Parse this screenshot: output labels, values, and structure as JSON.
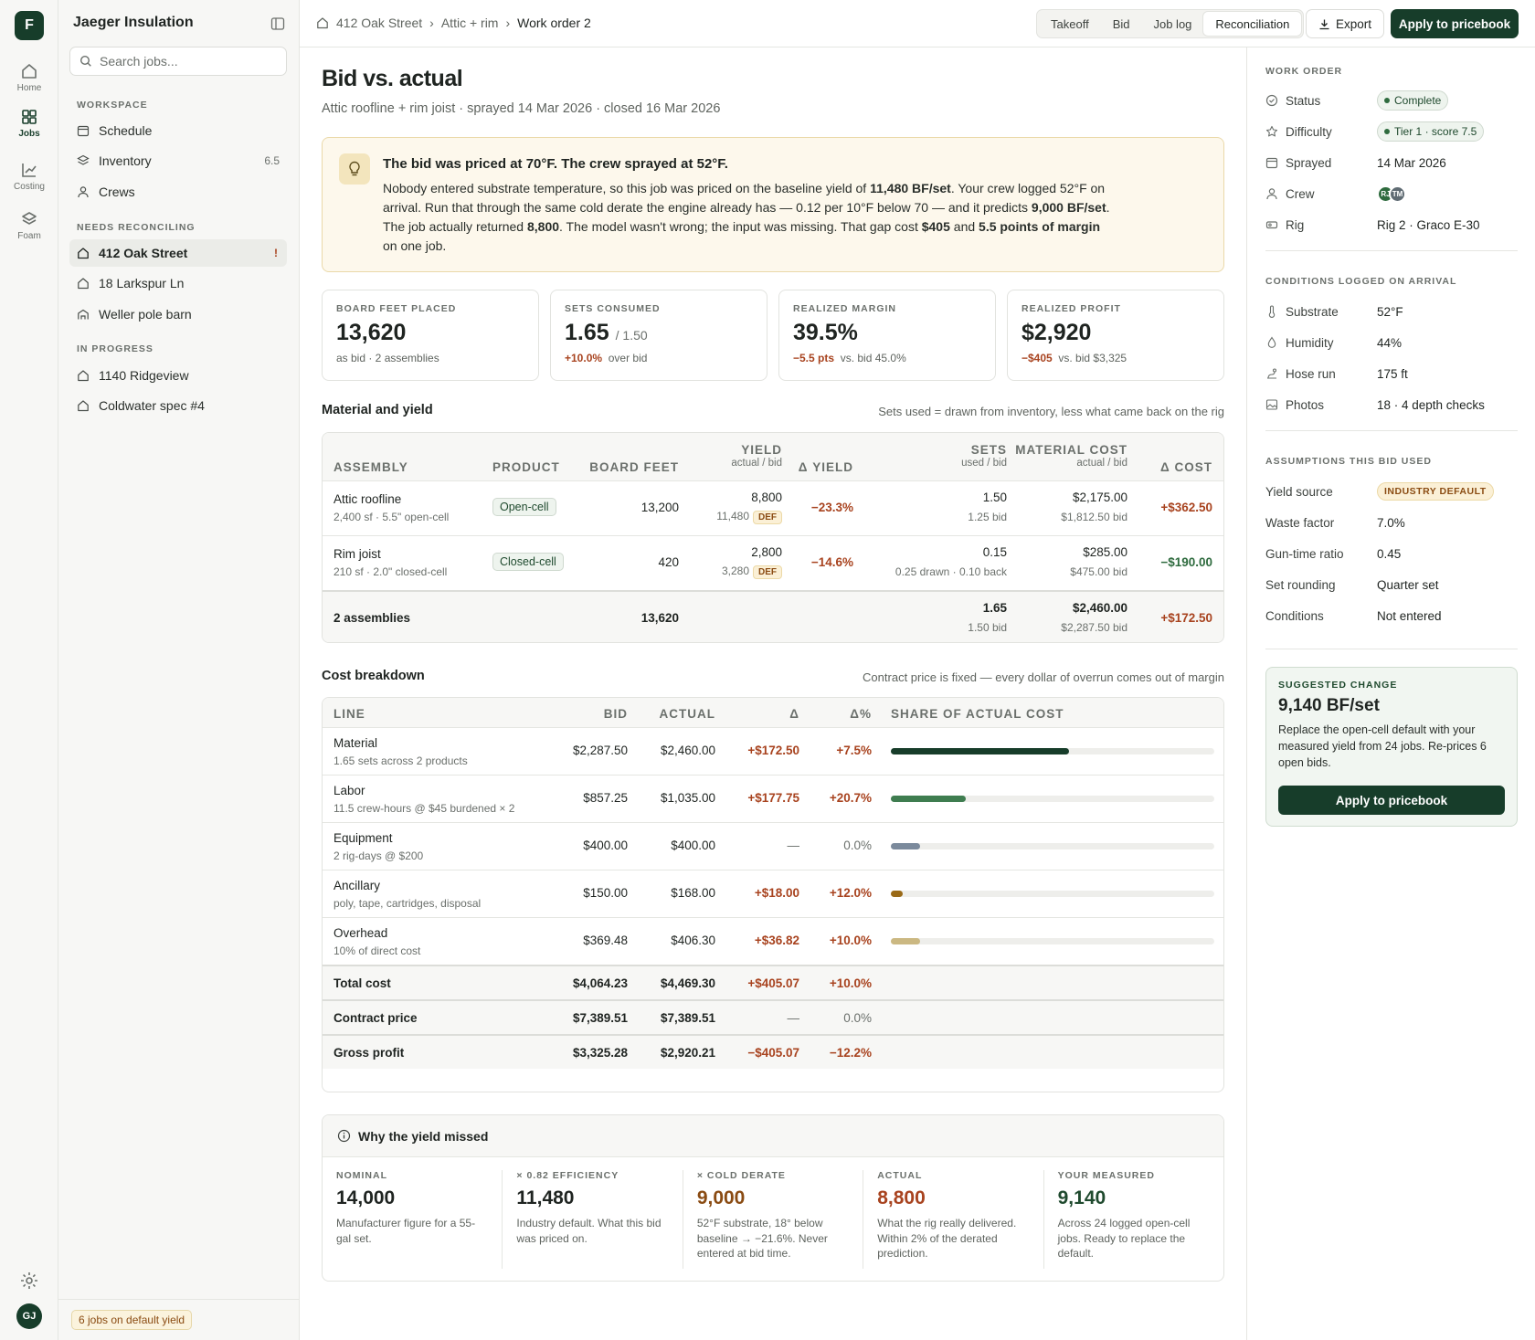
{
  "app": {
    "brand": "Jaeger Insulation",
    "logo_letter": "F",
    "user_initials": "GJ"
  },
  "rail": [
    {
      "label": "Home",
      "icon": "home-icon"
    },
    {
      "label": "Jobs",
      "icon": "jobs-icon"
    },
    {
      "label": "Costing",
      "icon": "costing-icon"
    },
    {
      "label": "Foam",
      "icon": "foam-icon"
    }
  ],
  "sidebar": {
    "search_placeholder": "Search jobs...",
    "workspace_label": "WORKSPACE",
    "workspace": [
      {
        "label": "Schedule",
        "count": ""
      },
      {
        "label": "Inventory",
        "count": "6.5"
      },
      {
        "label": "Crews",
        "count": ""
      }
    ],
    "reconciling_label": "NEEDS RECONCILING",
    "reconciling": [
      {
        "label": "412 Oak Street",
        "alert": "!"
      },
      {
        "label": "18 Larkspur Ln",
        "alert": ""
      },
      {
        "label": "Weller pole barn",
        "alert": ""
      }
    ],
    "progress_label": "IN PROGRESS",
    "progress": [
      {
        "label": "1140 Ridgeview"
      },
      {
        "label": "Coldwater spec #4"
      }
    ],
    "footer_badge": "6 jobs on default yield"
  },
  "topbar": {
    "breadcrumb": [
      "412 Oak Street",
      "Attic + rim",
      "Work order 2"
    ],
    "tabs": [
      "Takeoff",
      "Bid",
      "Job log",
      "Reconciliation"
    ],
    "active_tab": "Reconciliation",
    "export_label": "Export",
    "apply_label": "Apply to pricebook"
  },
  "page": {
    "title": "Bid vs. actual",
    "subtitle": "Attic roofline + rim joist · sprayed 14 Mar 2026 · closed 16 Mar 2026"
  },
  "callout": {
    "title": "The bid was priced at 70°F. The crew sprayed at 52°F.",
    "body": [
      {
        "t": "Nobody entered substrate temperature, so this job was priced on the baseline yield of ",
        "b": false
      },
      {
        "t": "11,480 BF/set",
        "b": true
      },
      {
        "t": ". Your crew logged 52°F on arrival. Run that through the same cold derate the engine already has — 0.12 per 10°F below 70 — and it predicts ",
        "b": false
      },
      {
        "t": "9,000 BF/set",
        "b": true
      },
      {
        "t": ". The job actually returned ",
        "b": false
      },
      {
        "t": "8,800",
        "b": true
      },
      {
        "t": ". The model wasn't wrong; the input was missing. That gap cost ",
        "b": false
      },
      {
        "t": "$405",
        "b": true
      },
      {
        "t": " and ",
        "b": false
      },
      {
        "t": "5.5 points of margin",
        "b": true
      },
      {
        "t": " on one job.",
        "b": false
      }
    ]
  },
  "kpis": [
    {
      "label": "BOARD FEET PLACED",
      "value": "13,620",
      "suffix": "",
      "delta": "",
      "sub": "as bid · 2 assemblies"
    },
    {
      "label": "SETS CONSUMED",
      "value": "1.65",
      "suffix": "/ 1.50",
      "delta": "+10.0%",
      "sub": "over bid"
    },
    {
      "label": "REALIZED MARGIN",
      "value": "39.5%",
      "suffix": "",
      "delta": "−5.5 pts",
      "sub": "vs. bid 45.0%"
    },
    {
      "label": "REALIZED PROFIT",
      "value": "$2,920",
      "suffix": "",
      "delta": "−$405",
      "sub": "vs. bid $3,325"
    }
  ],
  "material": {
    "title": "Material and yield",
    "note": "Sets used = drawn from inventory, less what came back on the rig",
    "headers": {
      "assembly": "ASSEMBLY",
      "product": "PRODUCT",
      "board_feet": "BOARD FEET",
      "yield": "YIELD",
      "yield_sub": "actual / bid",
      "d_yield": "Δ YIELD",
      "sets": "SETS",
      "sets_sub": "used / bid",
      "cost": "MATERIAL COST",
      "cost_sub": "actual / bid",
      "d_cost": "Δ COST"
    },
    "rows": [
      {
        "assembly": "Attic roofline",
        "detail": "2,400 sf · 5.5\" open-cell",
        "product": "Open-cell",
        "board_feet": "13,200",
        "yield_actual": "8,800",
        "yield_bid": "11,480",
        "def": "DEF",
        "d_yield": "−23.3%",
        "sets_used": "1.50",
        "sets_bid": "1.25 bid",
        "cost_actual": "$2,175.00",
        "cost_bid": "$1,812.50 bid",
        "d_cost": "+$362.50"
      },
      {
        "assembly": "Rim joist",
        "detail": "210 sf · 2.0\" closed-cell",
        "product": "Closed-cell",
        "board_feet": "420",
        "yield_actual": "2,800",
        "yield_bid": "3,280",
        "def": "DEF",
        "d_yield": "−14.6%",
        "sets_used": "0.15",
        "sets_bid": "0.25 drawn · 0.10 back",
        "cost_actual": "$285.00",
        "cost_bid": "$475.00 bid",
        "d_cost": "−$190.00"
      }
    ],
    "total": {
      "label": "2 assemblies",
      "board_feet": "13,620",
      "sets_used": "1.65",
      "sets_bid": "1.50 bid",
      "cost_actual": "$2,460.00",
      "cost_bid": "$2,287.50 bid",
      "d_cost": "+$172.50"
    }
  },
  "cost": {
    "title": "Cost breakdown",
    "note": "Contract price is fixed — every dollar of overrun comes out of margin",
    "headers": {
      "line": "LINE",
      "bid": "BID",
      "actual": "ACTUAL",
      "delta": "Δ",
      "pct": "Δ%",
      "share": "SHARE OF ACTUAL COST"
    },
    "rows": [
      {
        "line": "Material",
        "detail": "1.65 sets across 2 products",
        "bid": "$2,287.50",
        "actual": "$2,460.00",
        "delta": "+$172.50",
        "pct": "+7.5%",
        "share": 0.55,
        "color": "#173d2a"
      },
      {
        "line": "Labor",
        "detail": "11.5 crew-hours @ $45 burdened × 2",
        "bid": "$857.25",
        "actual": "$1,035.00",
        "delta": "+$177.75",
        "pct": "+20.7%",
        "share": 0.232,
        "color": "#3f7d50"
      },
      {
        "line": "Equipment",
        "detail": "2 rig-days @ $200",
        "bid": "$400.00",
        "actual": "$400.00",
        "delta": "—",
        "pct": "0.0%",
        "share": 0.09,
        "color": "#7b8a9c"
      },
      {
        "line": "Ancillary",
        "detail": "poly, tape, cartridges, disposal",
        "bid": "$150.00",
        "actual": "$168.00",
        "delta": "+$18.00",
        "pct": "+12.0%",
        "share": 0.038,
        "color": "#9a6a17"
      },
      {
        "line": "Overhead",
        "detail": "10% of direct cost",
        "bid": "$369.48",
        "actual": "$406.30",
        "delta": "+$36.82",
        "pct": "+10.0%",
        "share": 0.091,
        "color": "#cbb882"
      }
    ],
    "totals": [
      {
        "line": "Total cost",
        "bid": "$4,064.23",
        "actual": "$4,469.30",
        "delta": "+$405.07",
        "pct": "+10.0%"
      },
      {
        "line": "Contract price",
        "bid": "$7,389.51",
        "actual": "$7,389.51",
        "delta": "—",
        "pct": "0.0%"
      },
      {
        "line": "Gross profit",
        "bid": "$3,325.28",
        "actual": "$2,920.21",
        "delta": "−$405.07",
        "pct": "−12.2%"
      }
    ]
  },
  "why": {
    "title": "Why the yield missed",
    "cols": [
      {
        "label": "NOMINAL",
        "value": "14,000",
        "desc": "Manufacturer figure for a 55-gal set.",
        "color": "#1f2421"
      },
      {
        "label": "× 0.82 EFFICIENCY",
        "value": "11,480",
        "desc": "Industry default. What this bid was priced on.",
        "color": "#1f2421"
      },
      {
        "label": "× COLD DERATE",
        "value": "9,000",
        "desc": "52°F substrate, 18° below baseline → −21.6%. Never entered at bid time.",
        "color": "#8a4b12"
      },
      {
        "label": "ACTUAL",
        "value": "8,800",
        "desc": "What the rig really delivered. Within 2% of the derated prediction.",
        "color": "#a8431f"
      },
      {
        "label": "YOUR MEASURED",
        "value": "9,140",
        "desc": "Across 24 logged open-cell jobs. Ready to replace the default.",
        "color": "#1f4a2e"
      }
    ]
  },
  "right": {
    "wo_label": "WORK ORDER",
    "wo": {
      "status_k": "Status",
      "status_v": "Complete",
      "difficulty_k": "Difficulty",
      "difficulty_v": "Tier 1 · score 7.5",
      "sprayed_k": "Sprayed",
      "sprayed_v": "14 Mar 2026",
      "crew_k": "Crew",
      "crew": [
        "RJ",
        "TM"
      ],
      "rig_k": "Rig",
      "rig_v": "Rig 2 · Graco E-30"
    },
    "cond_label": "CONDITIONS LOGGED ON ARRIVAL",
    "cond": {
      "substrate_k": "Substrate",
      "substrate_v": "52°F",
      "humidity_k": "Humidity",
      "humidity_v": "44%",
      "hose_k": "Hose run",
      "hose_v": "175 ft",
      "photos_k": "Photos",
      "photos_v": "18 · 4 depth checks"
    },
    "assume_label": "ASSUMPTIONS THIS BID USED",
    "assume": {
      "yield_k": "Yield source",
      "yield_v": "INDUSTRY DEFAULT",
      "waste_k": "Waste factor",
      "waste_v": "7.0%",
      "gun_k": "Gun-time ratio",
      "gun_v": "0.45",
      "round_k": "Set rounding",
      "round_v": "Quarter set",
      "cond_k": "Conditions",
      "cond_v": "Not entered"
    },
    "suggest": {
      "label": "SUGGESTED CHANGE",
      "value": "9,140 BF/set",
      "desc": "Replace the open-cell default with your measured yield from 24 jobs. Re-prices 6 open bids.",
      "button": "Apply to pricebook"
    }
  },
  "colors": {
    "brand": "#173d2a",
    "negative": "#a8431f",
    "positive": "#2e6b3e",
    "amber": "#8a4b12"
  }
}
